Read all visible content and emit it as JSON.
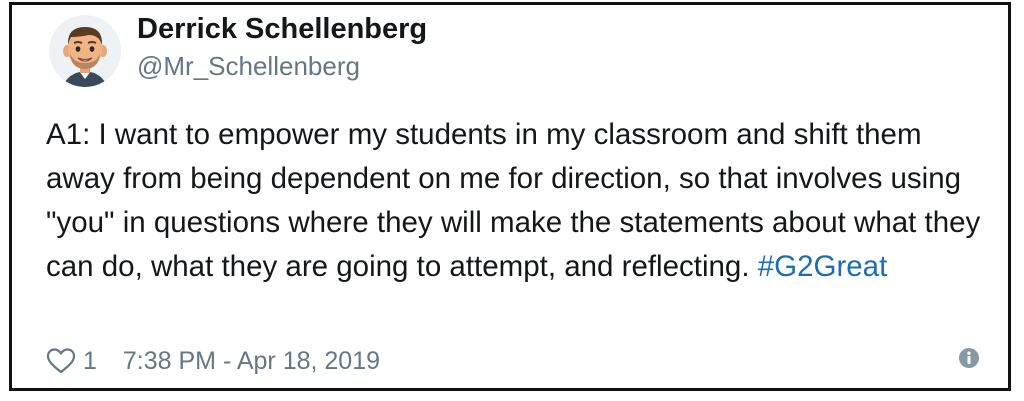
{
  "author": {
    "name": "Derrick Schellenberg",
    "handle": "@Mr_Schellenberg",
    "avatar_icon": "bitmoji-avatar-icon"
  },
  "tweet": {
    "text": "A1: I want to empower my students in my classroom and shift them away from being dependent on me for direction, so that involves using \"you\" in questions where they will make the statements about what they can do, what they are going to attempt, and reflecting.",
    "hashtag": "#G2Great"
  },
  "footer": {
    "like_icon": "heart-icon",
    "like_count": "1",
    "timestamp": "7:38 PM - Apr 18, 2019",
    "info_icon": "info-icon"
  },
  "colors": {
    "text": "#14171a",
    "secondary": "#657786",
    "hashtag": "#1b6db5",
    "border": "#111111"
  }
}
